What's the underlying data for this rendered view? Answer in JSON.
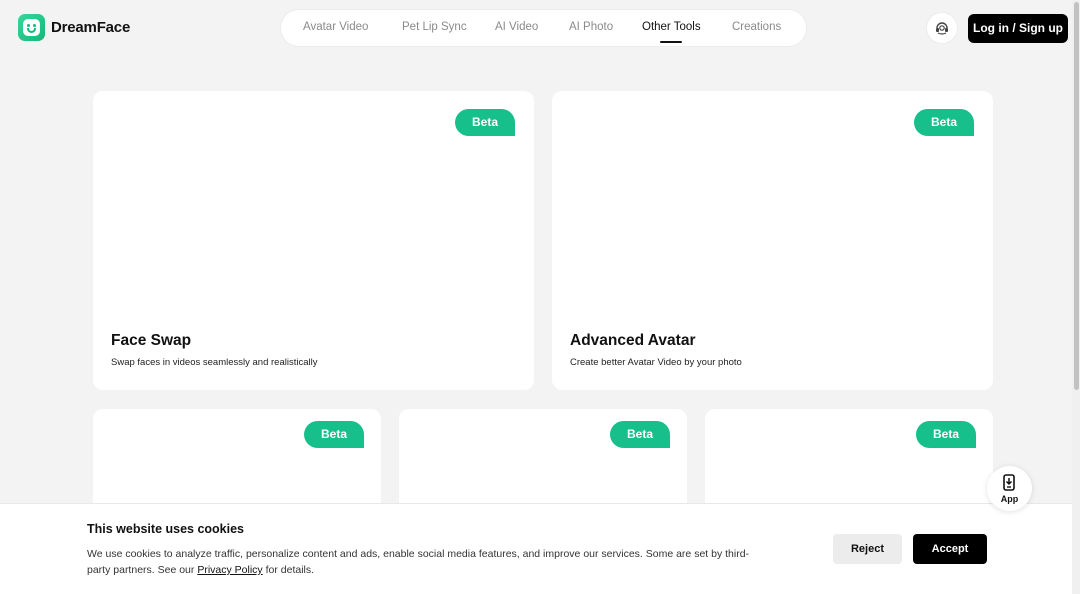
{
  "header": {
    "logo_text": "DreamFace",
    "nav": [
      {
        "label": "Avatar Video",
        "active": false
      },
      {
        "label": "Pet Lip Sync",
        "active": false
      },
      {
        "label": "AI Video",
        "active": false
      },
      {
        "label": "AI Photo",
        "active": false
      },
      {
        "label": "Other Tools",
        "active": true
      },
      {
        "label": "Creations",
        "active": false
      }
    ],
    "support_icon": "headset-icon",
    "login_label": "Log in / Sign up"
  },
  "cards": [
    {
      "badge": "Beta",
      "title": "Face Swap",
      "description": "Swap faces in videos seamlessly and realistically"
    },
    {
      "badge": "Beta",
      "title": "Advanced Avatar",
      "description": "Create better Avatar Video by your photo"
    },
    {
      "badge": "Beta",
      "title": "",
      "description": ""
    },
    {
      "badge": "Beta",
      "title": "",
      "description": ""
    },
    {
      "badge": "Beta",
      "title": "",
      "description": ""
    }
  ],
  "app_float": {
    "label": "App",
    "icon": "phone-download-icon"
  },
  "cookie_banner": {
    "title": "This website uses cookies",
    "text_before": "We use cookies to analyze traffic, personalize content and ads, enable social media features, and improve our services. Some are set by third-party partners. See our ",
    "link_label": "Privacy Policy",
    "text_after": " for details.",
    "reject_label": "Reject",
    "accept_label": "Accept"
  },
  "colors": {
    "accent": "#17c08a",
    "background": "#f3f3f3",
    "button_dark": "#000000"
  }
}
